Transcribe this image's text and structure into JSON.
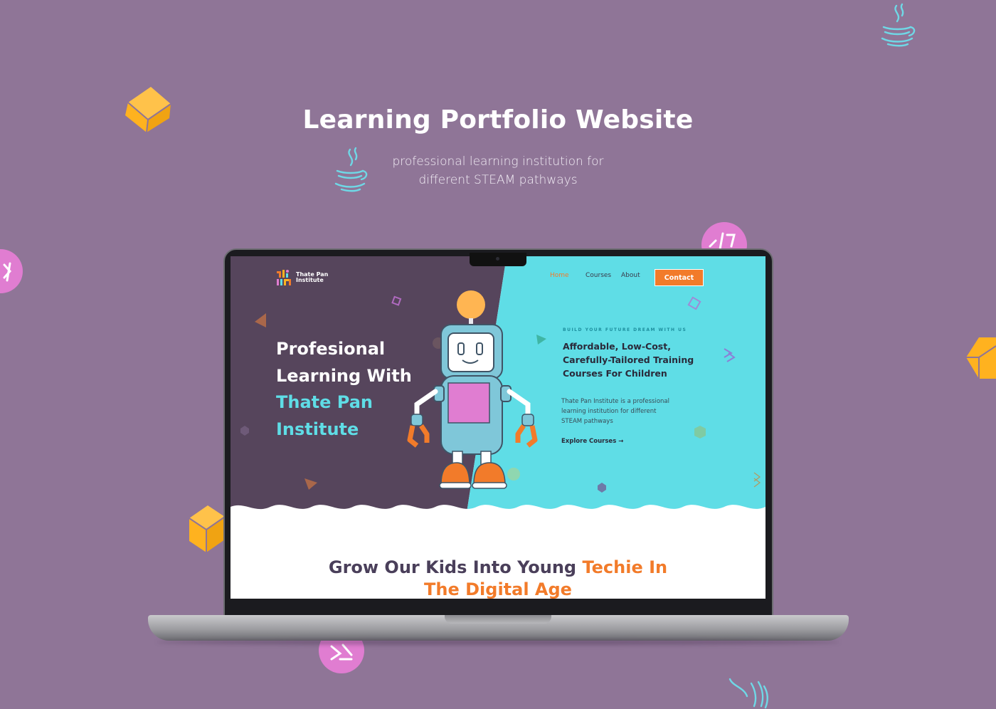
{
  "slide": {
    "title": "Learning Portfolio Website",
    "subtitle_line1": "professional learning institution for",
    "subtitle_line2": "different STEAM pathways"
  },
  "site": {
    "logo_line1": "Thate Pan",
    "logo_line2": "Institute",
    "nav": {
      "home": "Home",
      "courses": "Courses",
      "about": "About",
      "contact": "Contact"
    },
    "hero": {
      "title_line1": "Profesional",
      "title_line2": "Learning With",
      "title_line3": "Thate Pan",
      "title_line4": "Institute",
      "eyebrow": "BUILD YOUR FUTURE DREAM WITH US",
      "headline_line1": "Affordable, Low-Cost,",
      "headline_line2": "Carefully-Tailored Training",
      "headline_line3": "Courses For Children",
      "blurb_line1": "Thate Pan Institute is a professional",
      "blurb_line2": "learning institution for different",
      "blurb_line3": "STEAM pathways",
      "explore": "Explore Courses →"
    },
    "section": {
      "line1_dark": "Grow Our Kids Into Young ",
      "line1_orange": "Techie In",
      "line2_orange": "The Digital Age"
    }
  },
  "colors": {
    "background": "#8f7597",
    "hero_dark": "#56455c",
    "hero_cyan": "#5fdde6",
    "accent_orange": "#f27b2a",
    "cube_yellow": "#ffb21f",
    "badge_pink": "#e07dd1"
  },
  "icons": [
    "java-cup-icon",
    "code-tag-icon",
    "cube-icon",
    "robot-illustration",
    "arrow-right-icon"
  ]
}
